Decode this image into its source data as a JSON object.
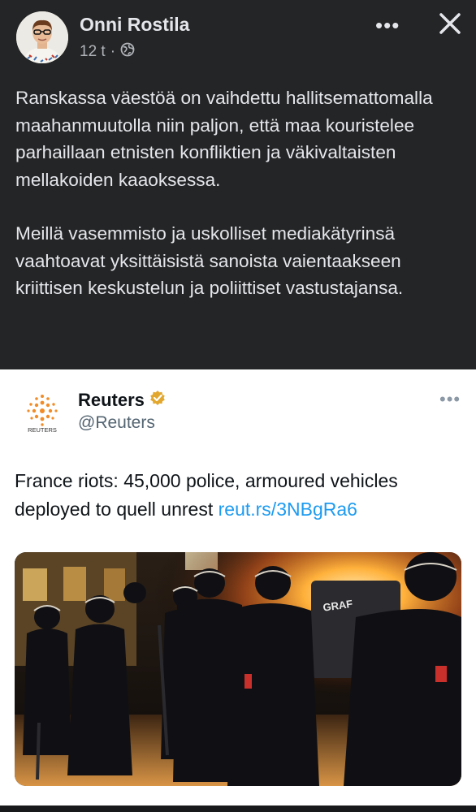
{
  "post": {
    "author": "Onni Rostila",
    "time": "12 t",
    "separator": "·",
    "more": "•••",
    "paragraphs": [
      "Ranskassa väestöä on vaihdettu hallitsemattomalla maahanmuutolla niin paljon, että maa kouristelee parhaillaan etnisten konfliktien ja väkivaltaisten mellakoiden kaaoksessa.",
      "Meillä vasemmisto ja uskolliset mediakätyrinsä vaahtoavat yksittäisistä sanoista vaientaakseen kriittisen keskustelun ja poliittiset vastustajansa."
    ]
  },
  "tweet": {
    "name": "Reuters",
    "handle": "@Reuters",
    "logo_text": "REUTERS",
    "more": "•••",
    "text": "France riots: 45,000 police, armoured vehicles deployed to quell unrest ",
    "link": "reut.rs/3NBgRa6"
  },
  "colors": {
    "post_bg": "#242526",
    "link": "#1d9bf0",
    "verified": "#e2a72e",
    "reuters_orange": "#f28c28"
  },
  "icons": [
    "globe-icon",
    "more-icon",
    "close-icon",
    "verified-badge-icon",
    "reuters-logo-icon"
  ]
}
